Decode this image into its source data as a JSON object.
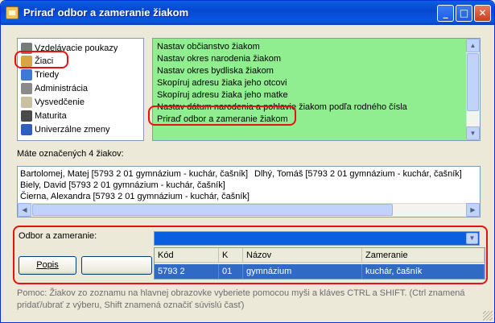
{
  "window": {
    "title": "Priraď odbor a zameranie žiakom",
    "minimize": "_",
    "maximize": "□",
    "close": "✕"
  },
  "tree": {
    "items": [
      {
        "label": "Vzdelávacie poukazy",
        "icon": "coupon-icon",
        "color": "#7a7a7a"
      },
      {
        "label": "Žiaci",
        "icon": "students-icon",
        "color": "#d9a441"
      },
      {
        "label": "Triedy",
        "icon": "classes-icon",
        "color": "#3a7bd5"
      },
      {
        "label": "Administrácia",
        "icon": "administration-icon",
        "color": "#8a8a8a"
      },
      {
        "label": "Vysvedčenie",
        "icon": "report-card-icon",
        "color": "#c8c0a0"
      },
      {
        "label": "Maturita",
        "icon": "maturita-icon",
        "color": "#4a4a4a"
      },
      {
        "label": "Univerzálne zmeny",
        "icon": "universal-changes-icon",
        "color": "#2e5fc0"
      }
    ]
  },
  "actions": {
    "items": [
      "Nastav občianstvo žiakom",
      "Nastav okres narodenia žiakom",
      "Nastav okres bydliska žiakom",
      "Skopíruj adresu žiaka jeho otcovi",
      "Skopíruj adresu žiaka jeho matke",
      "Nastav dátum narodenia a pohlavie žiakom podľa rodného čísla",
      "Priraď odbor a zameranie žiakom"
    ]
  },
  "selection": {
    "summary": "Máte označených 4 žiakov:",
    "students": [
      "Bartolomej, Matej [5793 2 01 gymnázium - kuchár, čašník]",
      "Dlhý, Tomáš [5793 2 01 gymnázium - kuchár, čašník]",
      "Biely, David [5793 2 01 gymnázium - kuchár, čašník]",
      "Čierna, Alexandra [5793 2 01 gymnázium - kuchár, čašník]"
    ]
  },
  "field": {
    "label": "Odbor a zameranie:",
    "value": ""
  },
  "grid": {
    "columns": [
      "Kód",
      "K",
      "Názov",
      "Zameranie"
    ],
    "row": [
      "5793 2",
      "01",
      "gymnázium",
      "kuchár, čašník"
    ]
  },
  "buttons": {
    "popis": "Popis"
  },
  "help": "Pomoc: Žiakov zo zoznamu na hlavnej obrazovke vyberiete pomocou myši a kláves CTRL a SHIFT. (Ctrl znamená pridať/ubrať z výberu, Shift znamená označiť súvislú časť)",
  "colors": {
    "highlight_red": "#e81010",
    "action_green": "#90ee90",
    "selection_blue": "#316ac5",
    "titlebar_blue": "#0a5fe0"
  }
}
